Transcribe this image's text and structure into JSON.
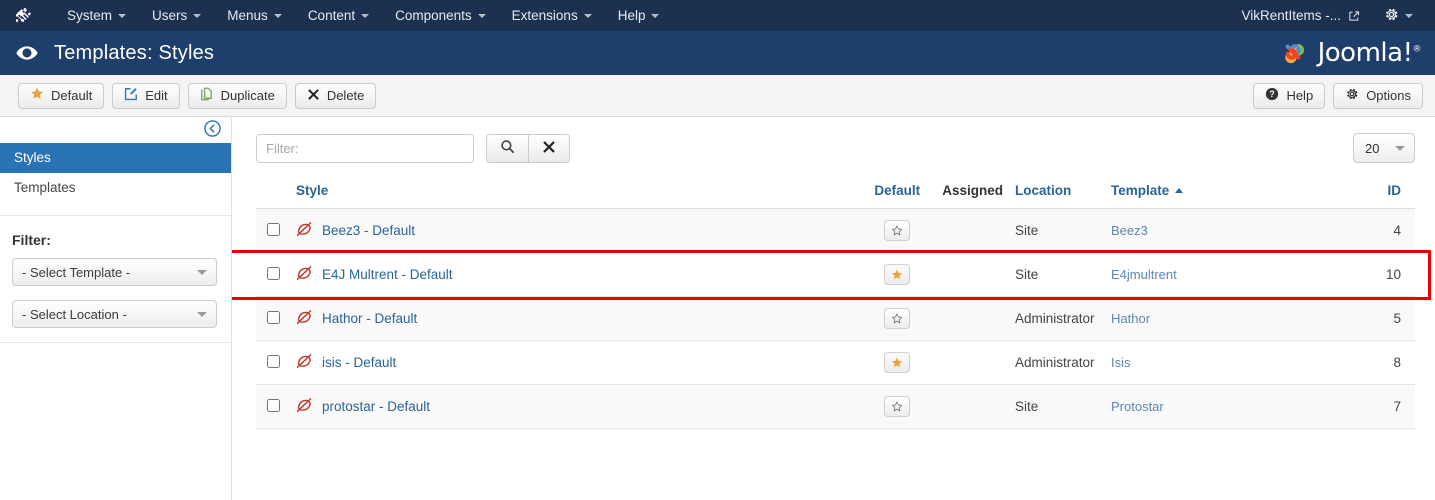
{
  "topbar": {
    "brand_icon": "joomla-mark-icon",
    "menu": [
      {
        "label": "System",
        "has_caret": true
      },
      {
        "label": "Users",
        "has_caret": true
      },
      {
        "label": "Menus",
        "has_caret": true
      },
      {
        "label": "Content",
        "has_caret": true
      },
      {
        "label": "Components",
        "has_caret": true
      },
      {
        "label": "Extensions",
        "has_caret": true
      },
      {
        "label": "Help",
        "has_caret": true
      }
    ],
    "site_link": "VikRentItems -...",
    "site_link_icon": "external-link-icon",
    "gear_icon": "gear-icon",
    "bg_color": "#1c3050"
  },
  "pageheader": {
    "icon": "eye-icon",
    "title": "Templates: Styles",
    "logo_text": "Joomla!",
    "logo_reg": "®",
    "bg_color": "#1e3e6b"
  },
  "toolbar": {
    "left": [
      {
        "label": "Default",
        "icon": "star-filled-icon"
      },
      {
        "label": "Edit",
        "icon": "pencil-square-icon"
      },
      {
        "label": "Duplicate",
        "icon": "copy-icon"
      },
      {
        "label": "Delete",
        "icon": "x-icon"
      }
    ],
    "right": [
      {
        "label": "Help",
        "icon": "question-circle-icon"
      },
      {
        "label": "Options",
        "icon": "gear-icon"
      }
    ]
  },
  "sidebar": {
    "collapse_icon": "chevron-left-circle-icon",
    "items": [
      {
        "label": "Styles",
        "active": true
      },
      {
        "label": "Templates",
        "active": false
      }
    ],
    "filter_heading": "Filter:",
    "selects": [
      {
        "name": "select-template",
        "value": "- Select Template -"
      },
      {
        "name": "select-location",
        "value": "- Select Location -"
      }
    ]
  },
  "main": {
    "filter_placeholder": "Filter:",
    "filter_value": "",
    "search_icon": "search-icon",
    "clear_icon": "x-icon",
    "list_limit": "20"
  },
  "table": {
    "columns": [
      {
        "key": "check",
        "label": "",
        "link": false,
        "sort": null
      },
      {
        "key": "style",
        "label": "Style",
        "link": true,
        "sort": null
      },
      {
        "key": "default",
        "label": "Default",
        "link": true,
        "sort": null
      },
      {
        "key": "assigned",
        "label": "Assigned",
        "link": false,
        "sort": null
      },
      {
        "key": "location",
        "label": "Location",
        "link": true,
        "sort": null
      },
      {
        "key": "template",
        "label": "Template",
        "link": true,
        "sort": "asc"
      },
      {
        "key": "id",
        "label": "ID",
        "link": true,
        "sort": null
      }
    ],
    "rows": [
      {
        "style": "Beez3 - Default",
        "icon": "template-style-icon",
        "is_default": false,
        "assigned": "",
        "location": "Site",
        "template": "Beez3",
        "id": "4"
      },
      {
        "style": "E4J Multrent - Default",
        "icon": "template-style-icon",
        "is_default": true,
        "assigned": "",
        "location": "Site",
        "template": "E4jmultrent",
        "id": "10"
      },
      {
        "style": "Hathor - Default",
        "icon": "template-style-icon",
        "is_default": false,
        "assigned": "",
        "location": "Administrator",
        "template": "Hathor",
        "id": "5"
      },
      {
        "style": "isis - Default",
        "icon": "template-style-icon",
        "is_default": true,
        "assigned": "",
        "location": "Administrator",
        "template": "Isis",
        "id": "8"
      },
      {
        "style": "protostar - Default",
        "icon": "template-style-icon",
        "is_default": false,
        "assigned": "",
        "location": "Site",
        "template": "Protostar",
        "id": "7"
      }
    ],
    "highlight_row_index": 1,
    "highlight_color": "#ee0000"
  }
}
